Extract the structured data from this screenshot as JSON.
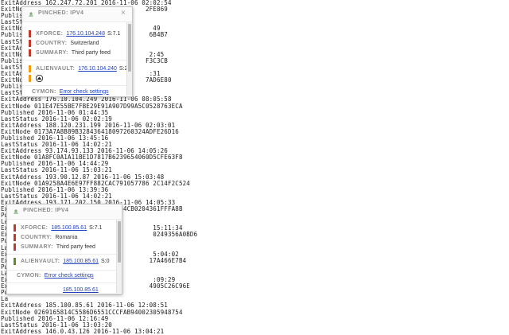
{
  "log_lines": [
    "ExitAddress 162.247.72.201 2016-11-06 02:02:54",
    "ExitNode                               2FE869",
    "Publish",
    "LastSta",
    "ExitNod                                  49",
    "Publish                                 6B4B7",
    "LastSta",
    "ExitAdd",
    "ExitNod                                 2:45",
    "Publish                                F3C3CB",
    "LastSta",
    "ExitAdd                                 :31",
    "ExitNod                                7AD6E80",
    "Publish",
    "LastStatus 2016-11-06 08:03:19",
    "ExitAddress 176.10.104.249 2016-11-06 08:05:58",
    "ExitNode 011E47E55BE7FBE29E91A907D99A5C0528763ECA",
    "Published 2016-11-06 01:44:35",
    "LastStatus 2016-11-06 02:02:19",
    "ExitAddress 188.120.231.199 2016-11-06 02:03:01",
    "ExitNode 0173A7A8B89B328436418097260324ADFE26D16",
    "Published 2016-11-06 13:45:16",
    "LastStatus 2016-11-06 14:02:21",
    "ExitAddress 93.174.93.133 2016-11-06 14:05:26",
    "ExitNode 01A8FC0A1A11BE1D7817B6239654060D5CFE63F8",
    "Published 2016-11-06 14:44:29",
    "LastStatus 2016-11-06 15:03:21",
    "ExitAddress 193.90.12.87 2016-11-06 15:03:48",
    "ExitNode 01A9258A4E6E97FF882CAC791057786 2C14F2C524",
    "Published 2016-11-06 13:39:36",
    "LastStatus 2016-11-06 14:02:21",
    "ExitAddress 193.171.202.150 2016-11-06 14:05:33",
    "ExitNode 01C670EC4FE97114EE63C7564CB0204361FFFA8B",
    "Pub",
    "La",
    "Ex                                       15:11:34",
    "Ex                                       0249356A0BD6",
    "Pu",
    "La",
    "Ex                                       5:04:02",
    "Ex                                      17A466E7B4",
    "Pu",
    "La",
    "Ex                                       :09:29",
    "Ex                                      4905C26C96E",
    "Pu",
    "La",
    "ExitAddress 185.100.85.61 2016-11-06 12:08:51",
    "ExitNode 0269165814C5586D6551CCCFAB94002305948754",
    "Published 2016-11-06 12:16:49",
    "LastStatus 2016-11-06 13:03:20",
    "ExitAddress 146.0.43.126 2016-11-06 13:04:21"
  ],
  "popups": [
    {
      "title": "PINCHED: IPV4",
      "close": "×",
      "rows": [
        {
          "label": "XFORCE:",
          "link": "176.10.104.248",
          "value": "S:7.1",
          "color": "#c0392b"
        },
        {
          "label": "COUNTRY:",
          "link": "",
          "value": "Switzerland",
          "color": "#c0392b"
        },
        {
          "label": "SUMMARY:",
          "link": "",
          "value": "Third party feed",
          "color": "#c0392b"
        },
        {
          "label": "ALIENVAULT:",
          "link": "176.10.104.240",
          "value": "S:2",
          "color": "#f39c12"
        }
      ],
      "av_icon": "alienvault-icon",
      "av_bar_color": "#f39c12",
      "cymon_label": "CYMON:",
      "cymon_link": "Error check settings"
    },
    {
      "title": "PINCHED: IPV4",
      "close": "",
      "rows": [
        {
          "label": "XFORCE:",
          "link": "185.100.85.61",
          "value": "S:7.1",
          "color": "#c0392b"
        },
        {
          "label": "COUNTRY:",
          "link": "",
          "value": "Romania",
          "color": "#c0392b"
        },
        {
          "label": "SUMMARY:",
          "link": "",
          "value": "Third party feed",
          "color": "#c0392b"
        },
        {
          "label": "ALIENVAULT:",
          "link": "185.100.85.61",
          "value": "S:0",
          "color": "#5a8f29"
        }
      ],
      "cymon_label": "CYMON:",
      "cymon_link": "Error check settings",
      "bottom_peek": "185.100.85.61"
    }
  ]
}
